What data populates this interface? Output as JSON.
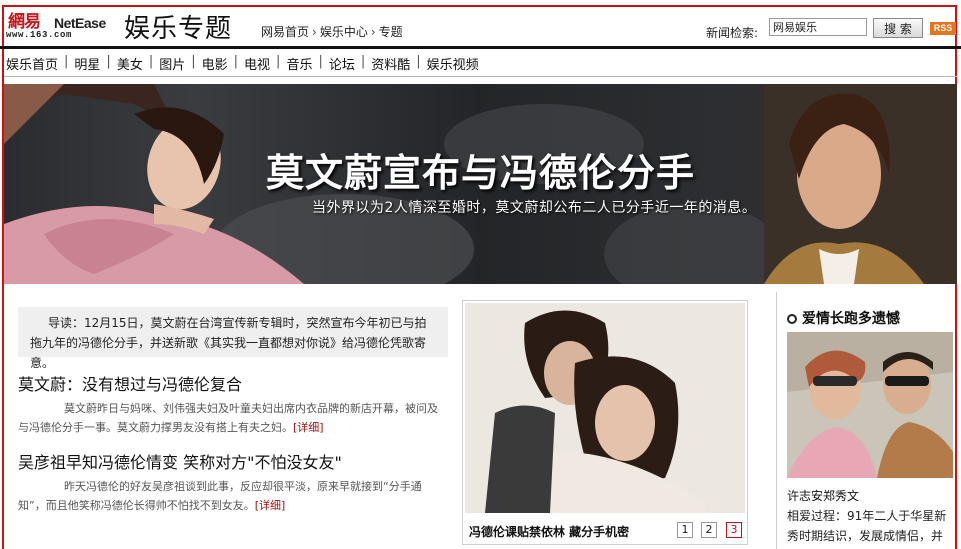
{
  "header": {
    "logo_cn": "網易",
    "logo_en": "NetEase",
    "logo_url": "www.163.com",
    "title": "娱乐专题",
    "breadcrumb": [
      "网易首页",
      "娱乐中心",
      "专题"
    ],
    "breadcrumb_sep": "›",
    "search_label": "新闻检索:",
    "search_value": "网易娱乐",
    "search_button": "搜 索",
    "rss": "RSS"
  },
  "nav": {
    "items": [
      "娱乐首页",
      "明星",
      "美女",
      "图片",
      "电影",
      "电视",
      "音乐",
      "论坛",
      "资料酷",
      "娱乐视频"
    ],
    "separator": "|"
  },
  "banner": {
    "headline": "莫文蔚宣布与冯德伦分手",
    "subline": "当外界以为2人情深至婚时，莫文蔚却公布二人已分手近一年的消息。"
  },
  "intro": {
    "text": "导读：12月15日，莫文蔚在台湾宣传新专辑时，突然宣布今年初已与拍拖九年的冯德伦分手，并送新歌《其实我一直都想对你说》给冯德伦凭歌寄意。"
  },
  "news": [
    {
      "title": "莫文蔚：没有想过与冯德伦复合",
      "body": "莫文蔚昨日与妈咪、刘伟强夫妇及叶童夫妇出席内衣品牌的新店开幕，被问及与冯德伦分手一事。莫文蔚力撑男友没有搭上有夫之妇。",
      "more": "[详细]"
    },
    {
      "title": "吴彦祖早知冯德伦情变  笑称对方\"不怕没女友\"",
      "body": "昨天冯德伦的好友吴彦祖谈到此事，反应却很平淡，原来早就接到“分手通知”，而且他笑称冯德伦长得帅不怕找不到女友。",
      "more": "[详细]"
    }
  ],
  "photo": {
    "caption": "冯德伦课贴禁依林  藏分手机密",
    "pages": [
      "1",
      "2",
      "3"
    ],
    "active_page": "3"
  },
  "side": {
    "title": "爱情长跑多遗憾",
    "caption": "许志安郑秀文",
    "text": "相爱过程：91年二人于华星新秀时期结识，发展成情侣，并"
  },
  "colors": {
    "brand_red": "#c8161d",
    "frame_red": "#d01010",
    "link_red": "#a01010",
    "rss_orange": "#e8731d"
  }
}
